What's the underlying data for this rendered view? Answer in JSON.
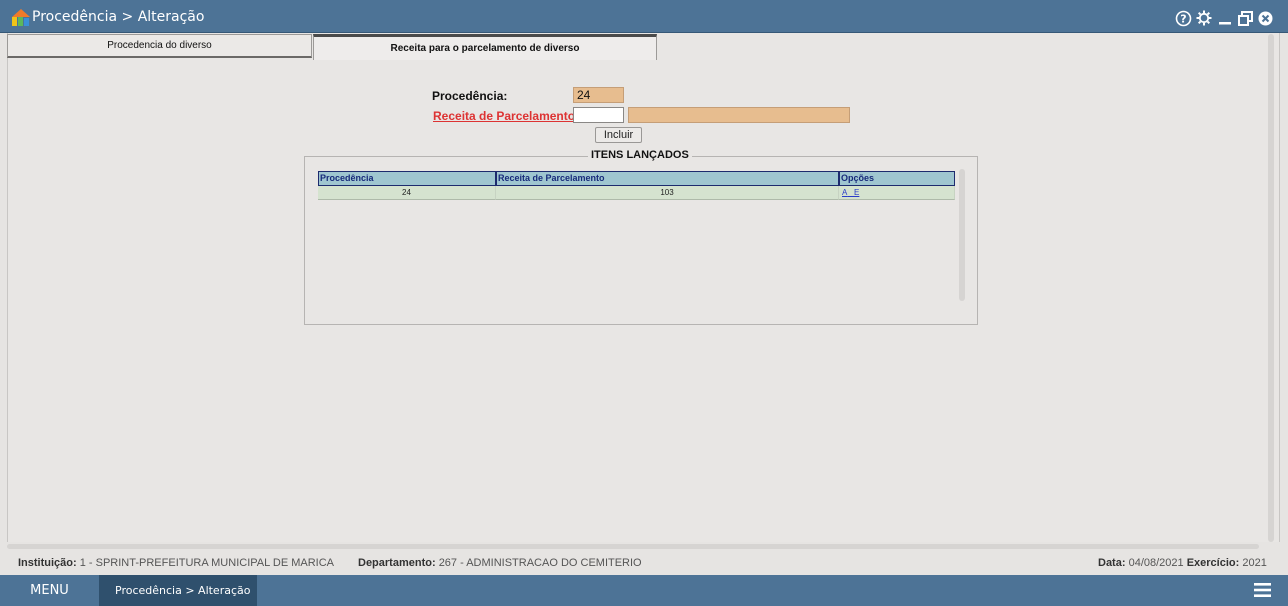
{
  "window": {
    "title": "Procedência > Alteração"
  },
  "tabs": [
    {
      "label": "Procedencia do diverso",
      "active": false
    },
    {
      "label": "Receita para o parcelamento de diverso",
      "active": true
    }
  ],
  "form": {
    "procedencia_label": "Procedência:",
    "procedencia_value": "24",
    "receita_label": "Receita de Parcelamento:",
    "receita_code": "",
    "receita_desc": "",
    "incluir_label": "Incluir"
  },
  "itens": {
    "legend": "ITENS LANÇADOS",
    "headers": [
      "Procedência",
      "Receita de Parcelamento",
      "Opções"
    ],
    "rows": [
      {
        "procedencia": "24",
        "receita": "103",
        "opt_a": "A",
        "opt_e": "E"
      }
    ]
  },
  "status": {
    "instituicao_label": "Instituição:",
    "instituicao_value": "1 - SPRINT-PREFEITURA MUNICIPAL DE MARICA",
    "departamento_label": "Departamento:",
    "departamento_value": "267 - ADMINISTRACAO DO CEMITERIO",
    "data_label": "Data:",
    "data_value": "04/08/2021",
    "exercicio_label": "Exercício:",
    "exercicio_value": "2021"
  },
  "bottom": {
    "menu_label": "MENU",
    "open_tab_label": "Procedência > Alteração"
  },
  "colors": {
    "titlebar": "#4d7396",
    "readonly_field": "#e7bd8f",
    "grid_header": "#9fc6d0",
    "grid_row": "#d5e3cf",
    "link_red": "#dd3333"
  },
  "icons": [
    "app-logo-icon",
    "help-icon",
    "gear-icon",
    "minimize-icon",
    "restore-icon",
    "close-icon",
    "hamburger-menu-icon"
  ]
}
